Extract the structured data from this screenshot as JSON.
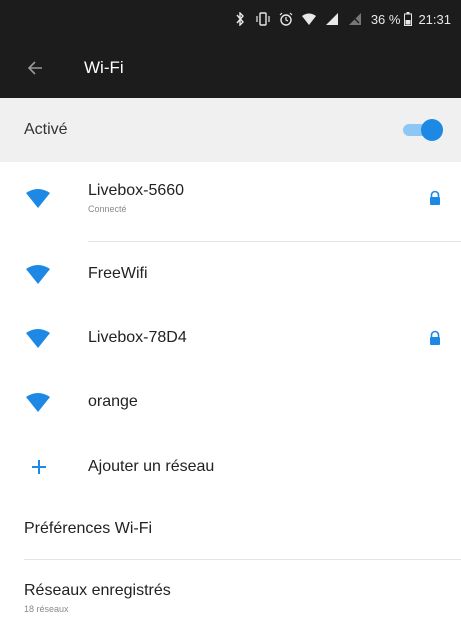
{
  "status_bar": {
    "battery_percent": "36 %",
    "time": "21:31",
    "icons": [
      "bluetooth-icon",
      "vibrate-icon",
      "alarm-icon",
      "wifi-signal-icon",
      "cell-signal-icon",
      "no-sim-icon",
      "battery-icon"
    ]
  },
  "app_bar": {
    "title": "Wi-Fi",
    "back_icon": "arrow-back-icon"
  },
  "wifi_toggle": {
    "label": "Activé",
    "state": "on",
    "accent_color": "#1e88e5"
  },
  "networks": [
    {
      "name": "Livebox-5660",
      "status": "Connecté",
      "secured": true
    },
    {
      "name": "FreeWifi",
      "status": "",
      "secured": false
    },
    {
      "name": "Livebox-78D4",
      "status": "",
      "secured": true
    },
    {
      "name": "orange",
      "status": "",
      "secured": false
    }
  ],
  "add_network": {
    "label": "Ajouter un réseau",
    "icon": "plus-icon"
  },
  "preferences": {
    "label": "Préférences Wi-Fi"
  },
  "saved_networks": {
    "label": "Réseaux enregistrés",
    "count_text": "18 réseaux"
  }
}
